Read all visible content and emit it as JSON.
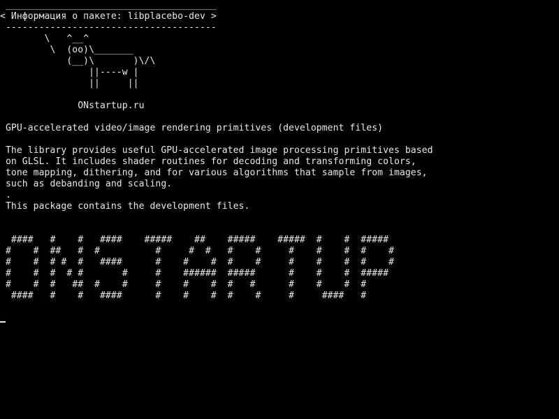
{
  "colors": {
    "background": "#000000",
    "foreground": "#e8e8e8"
  },
  "cowsay": {
    "border_top": " ______________________________________",
    "message": "< Информация о пакете: libplacebo-dev >",
    "border_bottom": " --------------------------------------",
    "cow_line_1": "        \\   ^__^",
    "cow_line_2": "         \\  (oo)\\_______",
    "cow_line_3": "            (__)\\       )\\/\\",
    "cow_line_4": "                ||----w |",
    "cow_line_5": "                ||     ||"
  },
  "site_name": "              ONstartup.ru",
  "package": {
    "summary": " GPU-accelerated video/image rendering primitives (development files)",
    "description_1": " The library provides useful GPU-accelerated image processing primitives based",
    "description_2": " on GLSL. It includes shader routines for decoding and transforming colors,",
    "description_3": " tone mapping, dithering, and for various algorithms that sample from images,",
    "description_4": " such as debanding and scaling.",
    "description_5": " .",
    "description_6": " This package contains the development files."
  },
  "banner": {
    "row_1": "  ####   #    #   ####    #####    ##    #####    #####  #    #  #####",
    "row_2": " #    #  ##   #  #          #     #  #   #    #     #    #    #  #    #",
    "row_3": " #    #  # #  #   ####      #    #    #  #    #     #    #    #  #    #",
    "row_4": " #    #  #  # #       #     #    ######  #####      #    #    #  #####",
    "row_5": " #    #  #   ##  #    #     #    #    #  #   #      #    #    #  #",
    "row_6": "  ####   #    #   ####      #    #    #  #    #     #     ####   #"
  }
}
